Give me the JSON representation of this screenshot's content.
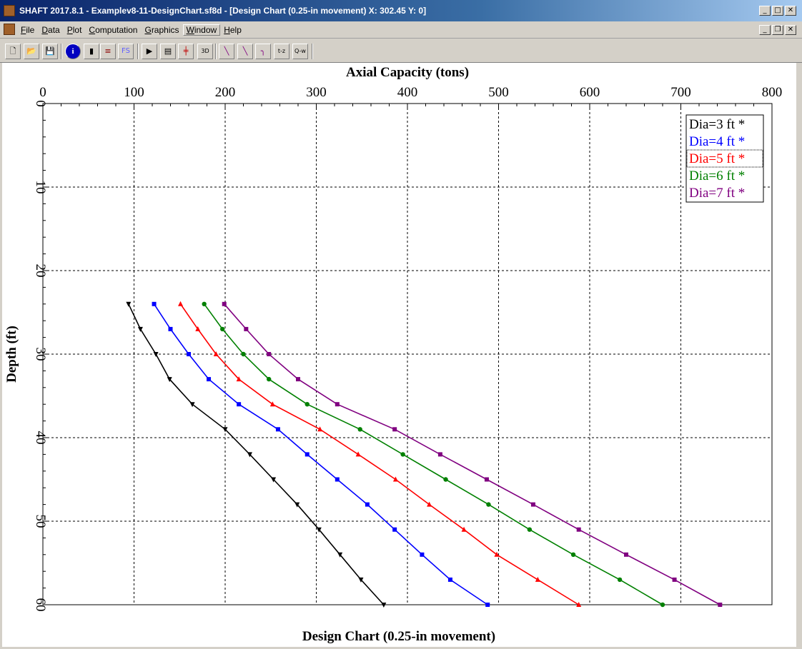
{
  "window": {
    "title": "SHAFT 2017.8.1 - Examplev8-11-DesignChart.sf8d - [Design Chart (0.25-in movement) X: 302.45 Y: 0]",
    "app_icon": "shaft-app-icon",
    "controls": {
      "minimize": "_",
      "maximize": "□",
      "close": "✕"
    }
  },
  "menubar": {
    "items": [
      {
        "label": "File",
        "accel": "F"
      },
      {
        "label": "Data",
        "accel": "D"
      },
      {
        "label": "Plot",
        "accel": "P"
      },
      {
        "label": "Computation",
        "accel": "C"
      },
      {
        "label": "Graphics",
        "accel": "G"
      },
      {
        "label": "Window",
        "accel": "W"
      },
      {
        "label": "Help",
        "accel": "H"
      }
    ],
    "active": "Window",
    "mdi_controls": {
      "minimize": "_",
      "restore": "❐",
      "close": "✕"
    }
  },
  "toolbar": {
    "buttons": [
      {
        "name": "new-file-icon",
        "glyph": "🗋"
      },
      {
        "name": "open-folder-icon",
        "glyph": "📂"
      },
      {
        "name": "save-icon",
        "glyph": "💾"
      },
      {
        "name": "info-icon",
        "glyph": "i"
      },
      {
        "name": "shaft-icon",
        "glyph": "▮"
      },
      {
        "name": "soil-layers-icon",
        "glyph": "≡"
      },
      {
        "name": "fs-icon",
        "glyph": "FS"
      },
      {
        "name": "run-icon",
        "glyph": "▶"
      },
      {
        "name": "report-icon",
        "glyph": "▤"
      },
      {
        "name": "section-icon",
        "glyph": "╪"
      },
      {
        "name": "3d-view-icon",
        "glyph": "3D"
      },
      {
        "name": "plot-curve-1-icon",
        "glyph": "╲"
      },
      {
        "name": "plot-curve-2-icon",
        "glyph": "╲"
      },
      {
        "name": "plot-curve-3-icon",
        "glyph": "╮"
      },
      {
        "name": "tz-curve-icon",
        "glyph": "t-z"
      },
      {
        "name": "qw-curve-icon",
        "glyph": "Q-w"
      }
    ]
  },
  "chart_data": {
    "type": "line",
    "title": "Design Chart (0.25-in movement)",
    "xlabel": "Axial Capacity (tons)",
    "ylabel": "Depth (ft)",
    "xlim": [
      0,
      800
    ],
    "ylim": [
      0,
      60
    ],
    "y_inverted": true,
    "x_axis_position": "top",
    "xticks": [
      "0",
      "100",
      "200",
      "300",
      "400",
      "500",
      "600",
      "700",
      "800"
    ],
    "yticks": [
      "0",
      "10",
      "20",
      "30",
      "40",
      "50",
      "60"
    ],
    "grid": true,
    "legend_position": "top-right",
    "depths": [
      24,
      27,
      30,
      33,
      36,
      39,
      42,
      45,
      48,
      51,
      54,
      57,
      60
    ],
    "series": [
      {
        "name": "Dia=3 ft *",
        "color": "#000000",
        "marker": "triangle-down",
        "values": [
          94,
          107,
          124,
          139,
          164,
          200,
          227,
          253,
          279,
          303,
          326,
          349,
          374
        ]
      },
      {
        "name": "Dia=4 ft *",
        "color": "#0000ff",
        "marker": "square",
        "values": [
          122,
          140,
          160,
          182,
          215,
          258,
          290,
          323,
          356,
          386,
          416,
          447,
          488
        ]
      },
      {
        "name": "Dia=5 ft *",
        "color": "#ff0000",
        "marker": "triangle-up",
        "values": [
          151,
          170,
          190,
          215,
          252,
          304,
          346,
          387,
          424,
          462,
          498,
          543,
          588
        ]
      },
      {
        "name": "Dia=6 ft *",
        "color": "#008000",
        "marker": "circle",
        "values": [
          177,
          197,
          220,
          248,
          290,
          348,
          395,
          442,
          489,
          534,
          582,
          633,
          680
        ]
      },
      {
        "name": "Dia=7 ft *",
        "color": "#800080",
        "marker": "square",
        "values": [
          199,
          223,
          248,
          280,
          323,
          386,
          436,
          487,
          538,
          588,
          640,
          693,
          743
        ]
      }
    ]
  }
}
